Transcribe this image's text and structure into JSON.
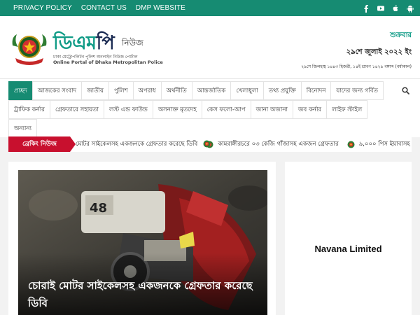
{
  "topbar": {
    "links": [
      "PRIVACY POLICY",
      "CONTACT US",
      "DMP WEBSITE"
    ],
    "social_icons": [
      "facebook-icon",
      "youtube-icon",
      "apple-icon",
      "android-icon"
    ]
  },
  "header": {
    "brand_title_a": "ডিএম",
    "brand_title_b": "পি",
    "brand_news": "নিউজ",
    "brand_sub_bn": "ঢাকা মেট্রোপলিটন পুলিশ অনলাইন নিউজ পোর্টাল",
    "brand_sub_en": "Online Portal of Dhaka Metropolitan Police",
    "weekday": "শুক্রবার",
    "date_main": "২৯শে জুলাই ২০২২ ইং",
    "date_sub": "২৯শে জিলহজ্ব ১৪৪৩ হিজরী, ১৪ই শ্রাবণ ১৪২৯ বঙ্গাব্দ (বর্ষাকাল)"
  },
  "nav": {
    "row1": [
      "প্রচ্ছদ",
      "আজকের সংবাদ",
      "জাতীয়",
      "পুলিশ",
      "অপরাধ",
      "অর্থনীতি",
      "আন্তর্জাতিক",
      "খেলাধুলা",
      "তথ্য প্রযুক্তি",
      "বিনোদন",
      "যাদের জন্য গর্বিত"
    ],
    "row2": [
      "ট্রাফিক কর্নার",
      "গ্রেফতারে সহায়তা",
      "লস্ট এন্ড ফাউন্ড",
      "অসনাক্ত মৃতদেহ",
      "কেস ফলো-আপ",
      "জানা অজানা",
      "জব কর্নার",
      "লাইফ স্টাইল"
    ],
    "row3": [
      "অন্যান্য"
    ]
  },
  "breaking": {
    "label": "ব্রেকিং নিউজ",
    "items": [
      "মোটর সাইকেলসহ একজনকে গ্রেফতার করেছে ডিবি",
      "কামরাঙ্গীরচরে ০৩ কেজি গাঁজাসহ একজন গ্রেফতার",
      "৯,০০০ পিস ইয়াবাসহ গ্রে"
    ]
  },
  "main": {
    "headline": "চোরাই মোটর সাইকেলসহ একজনকে গ্রেফতার করেছে ডিবি"
  },
  "ad": {
    "text": "Navana Limited"
  },
  "colors": {
    "brand_green": "#168b72",
    "breaking_red": "#c8102e"
  }
}
